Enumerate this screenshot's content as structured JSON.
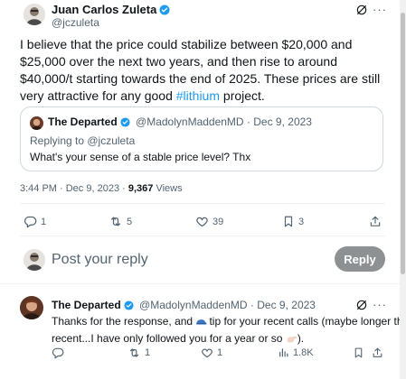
{
  "main_tweet": {
    "author_name": "Juan Carlos Zuleta",
    "handle": "@jczuleta",
    "text_before": "I believe that the price could stabilize between $20,000 and $25,000 over the next two years, and then rise to around $40,000/t starting towards the end of 2025. These prices are still very attractive for any good ",
    "hashtag": "#lithium",
    "text_after": " project.",
    "time": "3:44 PM · Dec 9, 2023 · ",
    "views_count": "9,367",
    "views_label": "Views",
    "replies": "1",
    "retweets": "5",
    "likes": "39",
    "bookmarks": "3"
  },
  "quoted_tweet": {
    "author_name": "The Departed",
    "handle_date": "@MadolynMaddenMD · Dec 9, 2023",
    "replying_to": "Replying to @jczuleta",
    "text": "What's your sense of a stable price level? Thx"
  },
  "composer": {
    "placeholder": "Post your reply",
    "button_label": "Reply"
  },
  "reply_tweet": {
    "author_name": "The Departed",
    "handle_date": "@MadolynMaddenMD · Dec 9, 2023",
    "line1_before": "Thanks for the response, and ",
    "line1_after": "tip for your recent calls (maybe longer than",
    "line2_before": "recent...I have only followed you for a year or so ",
    "line2_after": ").",
    "replies": "",
    "retweets": "1",
    "likes": "1",
    "views": "1.8K"
  },
  "colors": {
    "accent": "#1d9bf0",
    "text": "#0f1419",
    "muted": "#536471",
    "border": "#cfd9de",
    "reply_button": "#8e9194"
  },
  "icons": [
    "verified-badge-icon",
    "grok-icon",
    "more-icon",
    "reply-icon",
    "retweet-icon",
    "like-icon",
    "bookmark-icon",
    "share-icon",
    "views-icon",
    "cap-emoji-icon",
    "hand-emoji-icon"
  ]
}
